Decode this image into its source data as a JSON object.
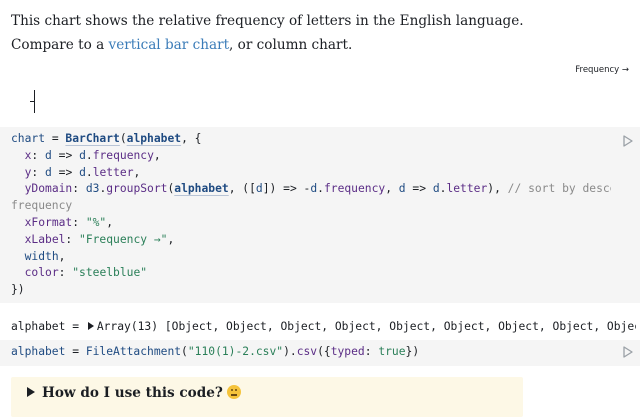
{
  "intro": {
    "text_before": "This chart shows the relative frequency of letters in the English language. Compare to a ",
    "link_text": "vertical bar chart",
    "text_after": ", or column chart."
  },
  "chart": {
    "x_axis_label": "Frequency →"
  },
  "cell1": {
    "code_lines": [
      [
        [
          "var",
          "chart"
        ],
        [
          "op",
          " = "
        ],
        [
          "fn",
          "BarChart"
        ],
        [
          "op",
          "("
        ],
        [
          "ref",
          "alphabet"
        ],
        [
          "op",
          ", {"
        ]
      ],
      [
        [
          "op",
          "  "
        ],
        [
          "prop",
          "x"
        ],
        [
          "op",
          ": "
        ],
        [
          "param",
          "d"
        ],
        [
          "op",
          " => "
        ],
        [
          "param",
          "d"
        ],
        [
          "op",
          "."
        ],
        [
          "prop",
          "frequency"
        ],
        [
          "op",
          ","
        ]
      ],
      [
        [
          "op",
          "  "
        ],
        [
          "prop",
          "y"
        ],
        [
          "op",
          ": "
        ],
        [
          "param",
          "d"
        ],
        [
          "op",
          " => "
        ],
        [
          "param",
          "d"
        ],
        [
          "op",
          "."
        ],
        [
          "prop",
          "letter"
        ],
        [
          "op",
          ","
        ]
      ],
      [
        [
          "op",
          "  "
        ],
        [
          "prop",
          "yDomain"
        ],
        [
          "op",
          ": "
        ],
        [
          "var",
          "d3"
        ],
        [
          "op",
          "."
        ],
        [
          "prop",
          "groupSort"
        ],
        [
          "op",
          "("
        ],
        [
          "ref",
          "alphabet"
        ],
        [
          "op",
          ", (["
        ],
        [
          "param",
          "d"
        ],
        [
          "op",
          "]) => -"
        ],
        [
          "param",
          "d"
        ],
        [
          "op",
          "."
        ],
        [
          "prop",
          "frequency"
        ],
        [
          "op",
          ", "
        ],
        [
          "param",
          "d"
        ],
        [
          "op",
          " => "
        ],
        [
          "param",
          "d"
        ],
        [
          "op",
          "."
        ],
        [
          "prop",
          "letter"
        ],
        [
          "op",
          "), "
        ],
        [
          "cmt",
          "// sort by descending"
        ]
      ],
      [
        [
          "cmt",
          "frequency"
        ]
      ],
      [
        [
          "op",
          "  "
        ],
        [
          "prop",
          "xFormat"
        ],
        [
          "op",
          ": "
        ],
        [
          "str",
          "\"%\""
        ],
        [
          "op",
          ","
        ]
      ],
      [
        [
          "op",
          "  "
        ],
        [
          "prop",
          "xLabel"
        ],
        [
          "op",
          ": "
        ],
        [
          "str",
          "\"Frequency →\""
        ],
        [
          "op",
          ","
        ]
      ],
      [
        [
          "op",
          "  "
        ],
        [
          "var",
          "width"
        ],
        [
          "op",
          ","
        ]
      ],
      [
        [
          "op",
          "  "
        ],
        [
          "prop",
          "color"
        ],
        [
          "op",
          ": "
        ],
        [
          "str",
          "\"steelblue\""
        ]
      ],
      [
        [
          "op",
          "})"
        ]
      ]
    ]
  },
  "output": {
    "name": "alphabet",
    "equals": " = ",
    "summary": "Array(13) [Object, Object, Object, Object, Object, Object, Object, Object, Object, O"
  },
  "cell2": {
    "code_lines": [
      [
        [
          "var",
          "alphabet"
        ],
        [
          "op",
          " = "
        ],
        [
          "var",
          "FileAttachment"
        ],
        [
          "op",
          "("
        ],
        [
          "str",
          "\"110(1)-2.csv\""
        ],
        [
          "op",
          ")."
        ],
        [
          "prop",
          "csv"
        ],
        [
          "op",
          "({"
        ],
        [
          "prop",
          "typed"
        ],
        [
          "op",
          ": "
        ],
        [
          "kw",
          "true"
        ],
        [
          "op",
          "})"
        ]
      ]
    ]
  },
  "howto": {
    "label": "How do I use this code?",
    "icon": "thinking-face-icon"
  },
  "icons": {
    "run": "play-icon",
    "expand": "triangle-right-icon"
  }
}
